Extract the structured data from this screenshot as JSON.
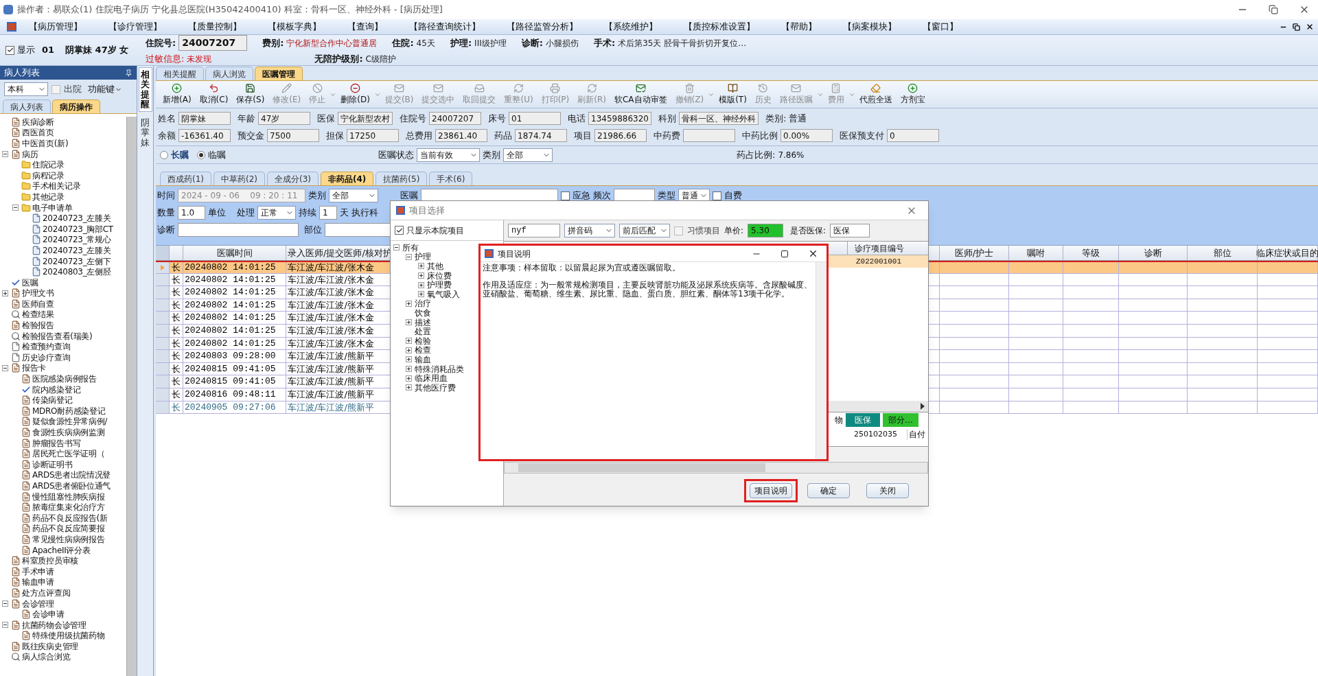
{
  "window": {
    "title": "操作者：易联众(1) 住院电子病历  宁化县总医院(H35042400410)  科室：骨科一区、神经外科 - [病历处理]"
  },
  "menu": [
    "【病历管理】",
    "【诊疗管理】",
    "【质量控制】",
    "【模板字典】",
    "【查询】",
    "【路径查询统计】",
    "【路径监管分析】",
    "【系统维护】",
    "【质控标准设置】",
    "【帮助】",
    "【病案模块】",
    "【窗口】"
  ],
  "patient_header": {
    "show": {
      "label": "显示",
      "checked": true
    },
    "bed": "01",
    "summary": "阴掌妹 47岁 女",
    "line_1": [
      {
        "label": "住院号:",
        "value": "24007207",
        "kind": "field"
      },
      {
        "label": "费别:",
        "value": "宁化新型合作中心普通居",
        "kind": "alert"
      },
      {
        "label": "住院:",
        "value": "45天",
        "kind": "text"
      },
      {
        "label": "护理:",
        "value": "III级护理",
        "kind": "text"
      },
      {
        "label": "诊断:",
        "value": "小腿损伤",
        "kind": "text"
      },
      {
        "label": "手术:",
        "value": "术后第35天   胫骨干骨折切开复位…",
        "kind": "text"
      }
    ],
    "line_2": [
      {
        "label": "过敏信息:",
        "value": "未发现",
        "kind": "warning"
      },
      {
        "label": "无陪护级别:",
        "value": "C级陪护",
        "kind": "text"
      }
    ]
  },
  "patient_panel": {
    "title": "病人列表",
    "scope": "本科",
    "discharged": {
      "label": "出院",
      "checked": false
    },
    "function_key": "功能键",
    "tabs": [
      {
        "label": "病人列表",
        "selected": false
      },
      {
        "label": "病历操作",
        "selected": true
      }
    ],
    "tree": [
      {
        "label": "疾病诊断",
        "kind": "doc"
      },
      {
        "label": "西医首页",
        "kind": "doc"
      },
      {
        "label": "中医首页(新)",
        "kind": "doc"
      },
      {
        "label": "病历",
        "kind": "doc",
        "expanded": true,
        "children": [
          {
            "label": "住院记录",
            "kind": "folder"
          },
          {
            "label": "病程记录",
            "kind": "folder"
          },
          {
            "label": "手术相关记录",
            "kind": "folder"
          },
          {
            "label": "其他记录",
            "kind": "folder"
          },
          {
            "label": "电子申请单",
            "kind": "folder",
            "expanded": true,
            "children": [
              {
                "label": "20240723_左膝关",
                "kind": "file"
              },
              {
                "label": "20240723_胸部CT",
                "kind": "file"
              },
              {
                "label": "20240723_常规心",
                "kind": "file"
              },
              {
                "label": "20240723_左膝关",
                "kind": "file"
              },
              {
                "label": "20240723_左侧下",
                "kind": "file"
              },
              {
                "label": "20240803_左侧胫",
                "kind": "file"
              }
            ]
          }
        ]
      },
      {
        "label": "医嘱",
        "kind": "check"
      },
      {
        "label": "护理文书",
        "kind": "doc",
        "expanded": false
      },
      {
        "label": "医师自查",
        "kind": "doc"
      },
      {
        "label": "检查结果",
        "kind": "search"
      },
      {
        "label": "检验报告",
        "kind": "doc"
      },
      {
        "label": "检验报告查看(瑞美)",
        "kind": "search"
      },
      {
        "label": "检查预约查询",
        "kind": "page"
      },
      {
        "label": "历史诊疗查询",
        "kind": "page"
      },
      {
        "label": "报告卡",
        "kind": "doc",
        "expanded": true,
        "children": [
          {
            "label": "医院感染病例报告",
            "kind": "doc"
          },
          {
            "label": "院内感染登记",
            "kind": "check"
          },
          {
            "label": "传染病登记",
            "kind": "doc"
          },
          {
            "label": "MDRO耐药感染登记",
            "kind": "doc"
          },
          {
            "label": "疑似食源性异常病例/",
            "kind": "doc"
          },
          {
            "label": "食源性疾病病例监测",
            "kind": "doc"
          },
          {
            "label": "肿瘤报告书写",
            "kind": "doc"
          },
          {
            "label": "居民死亡医学证明（",
            "kind": "doc"
          },
          {
            "label": "诊断证明书",
            "kind": "doc"
          },
          {
            "label": "ARDS患者出院情况登",
            "kind": "doc"
          },
          {
            "label": "ARDS患者俯卧位通气",
            "kind": "doc"
          },
          {
            "label": "慢性阻塞性肺疾病报",
            "kind": "doc"
          },
          {
            "label": "脓毒症集束化治疗方",
            "kind": "doc"
          },
          {
            "label": "药品不良反应报告(新",
            "kind": "doc"
          },
          {
            "label": "药品不良反应简要报",
            "kind": "doc"
          },
          {
            "label": "常见慢性病病例报告",
            "kind": "doc"
          },
          {
            "label": "ApacheII评分表",
            "kind": "doc"
          }
        ]
      },
      {
        "label": "科室质控员审核",
        "kind": "doc"
      },
      {
        "label": "手术申请",
        "kind": "doc"
      },
      {
        "label": "输血申请",
        "kind": "doc"
      },
      {
        "label": "处方点评查阅",
        "kind": "doc"
      },
      {
        "label": "会诊管理",
        "kind": "doc",
        "expanded": true,
        "children": [
          {
            "label": "会诊申请",
            "kind": "doc"
          }
        ]
      },
      {
        "label": "抗菌药物会诊管理",
        "kind": "doc",
        "expanded": true,
        "children": [
          {
            "label": "特殊使用级抗菌药物",
            "kind": "doc"
          }
        ]
      },
      {
        "label": "既往疾病史管理",
        "kind": "doc"
      },
      {
        "label": "病人综合浏览",
        "kind": "search"
      }
    ]
  },
  "side_tabs": [
    {
      "label": "相关提醒",
      "selected": true
    },
    {
      "label": "阴掌妹",
      "selected": false
    }
  ],
  "main_tabs": [
    {
      "label": "相关提醒",
      "selected": false
    },
    {
      "label": "病人浏览",
      "selected": false
    },
    {
      "label": "医嘱管理",
      "selected": true
    }
  ],
  "toolbar": [
    {
      "label": "新增(A)",
      "kind": "add",
      "disabled": false,
      "menu": false
    },
    {
      "label": "取消(C)",
      "kind": "undo",
      "disabled": false,
      "menu": false
    },
    {
      "label": "保存(S)",
      "kind": "save",
      "disabled": false,
      "menu": false
    },
    {
      "label": "修改(E)",
      "kind": "edit",
      "disabled": true,
      "menu": false
    },
    {
      "label": "停止",
      "kind": "stop",
      "disabled": true,
      "menu": true
    },
    {
      "label": "删除(D)",
      "kind": "remove",
      "disabled": false,
      "menu": true
    },
    {
      "label": "提交(B)",
      "kind": "mail",
      "disabled": true,
      "menu": false
    },
    {
      "label": "提交选中",
      "kind": "mail",
      "disabled": true,
      "menu": false
    },
    {
      "label": "取回提交",
      "kind": "inbox",
      "disabled": true,
      "menu": false
    },
    {
      "label": "重整(U)",
      "kind": "refresh",
      "disabled": true,
      "menu": false
    },
    {
      "label": "打印(P)",
      "kind": "print",
      "disabled": true,
      "menu": false
    },
    {
      "label": "刷新(R)",
      "kind": "refresh",
      "disabled": true,
      "menu": false
    },
    {
      "label": "软CA自动审签",
      "kind": "sign",
      "disabled": false,
      "menu": false
    },
    {
      "label": "撤销(Z)",
      "kind": "trash",
      "disabled": true,
      "menu": true
    },
    {
      "label": "模版(T)",
      "kind": "book",
      "disabled": false,
      "menu": false
    },
    {
      "label": "历史",
      "kind": "history",
      "disabled": true,
      "menu": false
    },
    {
      "label": "路径医嘱",
      "kind": "mail",
      "disabled": true,
      "menu": true
    },
    {
      "label": "费用",
      "kind": "calc",
      "disabled": true,
      "menu": true
    },
    {
      "label": "代煎全送",
      "kind": "eraser",
      "disabled": false,
      "menu": false
    },
    {
      "label": "方剂宝",
      "kind": "add",
      "disabled": false,
      "menu": false
    }
  ],
  "patient_info": [
    [
      {
        "label": "姓名",
        "value": "阴掌妹"
      },
      {
        "label": "年龄",
        "value": "47岁"
      },
      {
        "label": "医保",
        "value": "宁化新型农村"
      },
      {
        "label": "住院号",
        "value": "24007207"
      },
      {
        "label": "床号",
        "value": "01"
      },
      {
        "label": "电话",
        "value": "13459886320"
      },
      {
        "label": "科别",
        "value": "骨科一区、神经外科"
      },
      {
        "label": "类别:",
        "value": "普通",
        "kind": "text"
      }
    ],
    [
      {
        "label": "余额",
        "value": "-16361.40"
      },
      {
        "label": "预交金",
        "value": "7500"
      },
      {
        "label": "担保",
        "value": "17250"
      },
      {
        "label": "总费用",
        "value": "23861.40"
      },
      {
        "label": "药品",
        "value": "1874.74"
      },
      {
        "label": "项目",
        "value": "21986.66"
      },
      {
        "label": "中药费"
      },
      {
        "label": "中药比例",
        "value": "0.00%"
      },
      {
        "label": "医保预支付",
        "value": "0"
      }
    ]
  ],
  "order_filter": {
    "order_types": [
      {
        "label": "长嘱",
        "selected": false
      },
      {
        "label": "临嘱",
        "selected": true
      }
    ],
    "status_label": "医嘱状态",
    "status": "当前有效",
    "category_label": "类别",
    "category": "全部",
    "drug_ratio_label": "药占比例:",
    "drug_ratio": "7.86%"
  },
  "sub_tabs": [
    {
      "label": "西成药(1)",
      "selected": false
    },
    {
      "label": "中草药(2)",
      "selected": false
    },
    {
      "label": "全成分(3)",
      "selected": false
    },
    {
      "label": "非药品(4)",
      "selected": true
    },
    {
      "label": "抗菌药(5)",
      "selected": false
    },
    {
      "label": "手术(6)",
      "selected": false
    }
  ],
  "order_form": {
    "time_label": "时间",
    "time": "2024 - 09 - 06    09 : 20 : 11",
    "category_label": "类别",
    "category": "全部",
    "order_label": "医嘱",
    "urgent": {
      "label": "应急",
      "checked": false
    },
    "frequency_label": "频次",
    "type_label": "类型",
    "type": "普通",
    "self_pay": {
      "label": "自费",
      "checked": false
    },
    "quantity_label": "数量",
    "quantity": "1.0",
    "unit_label": "单位",
    "handling_label": "处理",
    "handling": "正常",
    "duration_label": "持续",
    "duration": "1",
    "day_label": "天",
    "dept_label": "执行科",
    "diagnosis_label": "诊断",
    "site_label": "部位"
  },
  "order_grid": {
    "left_columns": [
      "医嘱时间",
      "录入医师/提交医师/核对护"
    ],
    "right_columns": [
      "医师/护士",
      "嘱咐",
      "等级",
      "诊断",
      "部位",
      "临床症状或目的"
    ],
    "rows": [
      {
        "term": "长",
        "time": "20240802 14:01:25",
        "staff": "车江波/车江波/张木金",
        "selected": true,
        "color": "#000000"
      },
      {
        "term": "长",
        "time": "20240802 14:01:25",
        "staff": "车江波/车江波/张木金",
        "selected": false,
        "color": "#000000"
      },
      {
        "term": "长",
        "time": "20240802 14:01:25",
        "staff": "车江波/车江波/张木金",
        "selected": false,
        "color": "#000000"
      },
      {
        "term": "长",
        "time": "20240802 14:01:25",
        "staff": "车江波/车江波/张木金",
        "selected": false,
        "color": "#000000"
      },
      {
        "term": "长",
        "time": "20240802 14:01:25",
        "staff": "车江波/车江波/张木金",
        "selected": false,
        "color": "#000000"
      },
      {
        "term": "长",
        "time": "20240802 14:01:25",
        "staff": "车江波/车江波/张木金",
        "selected": false,
        "color": "#000000"
      },
      {
        "term": "长",
        "time": "20240802 14:01:25",
        "staff": "车江波/车江波/张木金",
        "selected": false,
        "color": "#000000"
      },
      {
        "term": "长",
        "time": "20240803 09:28:00",
        "staff": "车江波/车江波/熊新平",
        "selected": false,
        "color": "#000000"
      },
      {
        "term": "长",
        "time": "20240815 09:41:05",
        "staff": "车江波/车江波/熊新平",
        "selected": false,
        "color": "#000000"
      },
      {
        "term": "长",
        "time": "20240815 09:41:05",
        "staff": "车江波/车江波/熊新平",
        "selected": false,
        "color": "#000000"
      },
      {
        "term": "长",
        "time": "20240816 09:48:11",
        "staff": "车江波/车江波/熊新平",
        "selected": false,
        "color": "#000000"
      },
      {
        "term": "长",
        "time": "20240905 09:27:06",
        "staff": "车江波/车江波/熊新平",
        "selected": false,
        "color": "#2e6a86"
      }
    ]
  },
  "item_dialog": {
    "title": "项目选择",
    "local_only": {
      "label": "只显示本院项目",
      "checked": true
    },
    "tree": [
      {
        "label": "所有",
        "expanded": true,
        "children": [
          {
            "label": "护理",
            "expanded": true,
            "children": [
              {
                "label": "其他",
                "expanded": false
              },
              {
                "label": "床位费",
                "expanded": false
              },
              {
                "label": "护理费",
                "expanded": false
              },
              {
                "label": "氧气吸入",
                "expanded": false
              }
            ]
          },
          {
            "label": "治疗",
            "expanded": false
          },
          {
            "label": "饮食"
          },
          {
            "label": "描述",
            "expanded": false
          },
          {
            "label": "处置"
          },
          {
            "label": "检验",
            "expanded": false
          },
          {
            "label": "检查",
            "expanded": false
          },
          {
            "label": "输血",
            "expanded": false
          },
          {
            "label": "特殊消耗品类",
            "expanded": false
          },
          {
            "label": "临床用血",
            "expanded": false
          },
          {
            "label": "其他医疗费",
            "expanded": false
          }
        ]
      }
    ],
    "search": "nyf",
    "code_type": "拼音码",
    "match_mode": "前后匹配",
    "habitual": {
      "label": "习惯项目",
      "checked": false
    },
    "price_label": "单价:",
    "price": "5.30",
    "insurance_label": "是否医保:",
    "insurance": "医保",
    "grid_column": "诊疗项目编号",
    "grid_row": "Z022001001",
    "price_column": "物",
    "insurance_cell": "医保",
    "part_cell": "部分…",
    "price_code": "250102035",
    "price_note": "自付",
    "buttons": [
      {
        "label": "项目说明",
        "highlighted": true
      },
      {
        "label": "确定",
        "highlighted": false
      },
      {
        "label": "关闭",
        "highlighted": false
      }
    ]
  },
  "info_dialog": {
    "title": "项目说明",
    "highlighted": true,
    "paragraphs": [
      "注意事项：样本留取：以留晨起尿为宜或遵医嘱留取。",
      "作用及适应症：为一般常规检测项目，主要反映肾脏功能及泌尿系统疾病等。含尿酸碱度、亚硝酸盐、葡萄糖、维生素、尿比重、隐血、蛋白质、胆红素、酮体等13项干化学。"
    ]
  }
}
